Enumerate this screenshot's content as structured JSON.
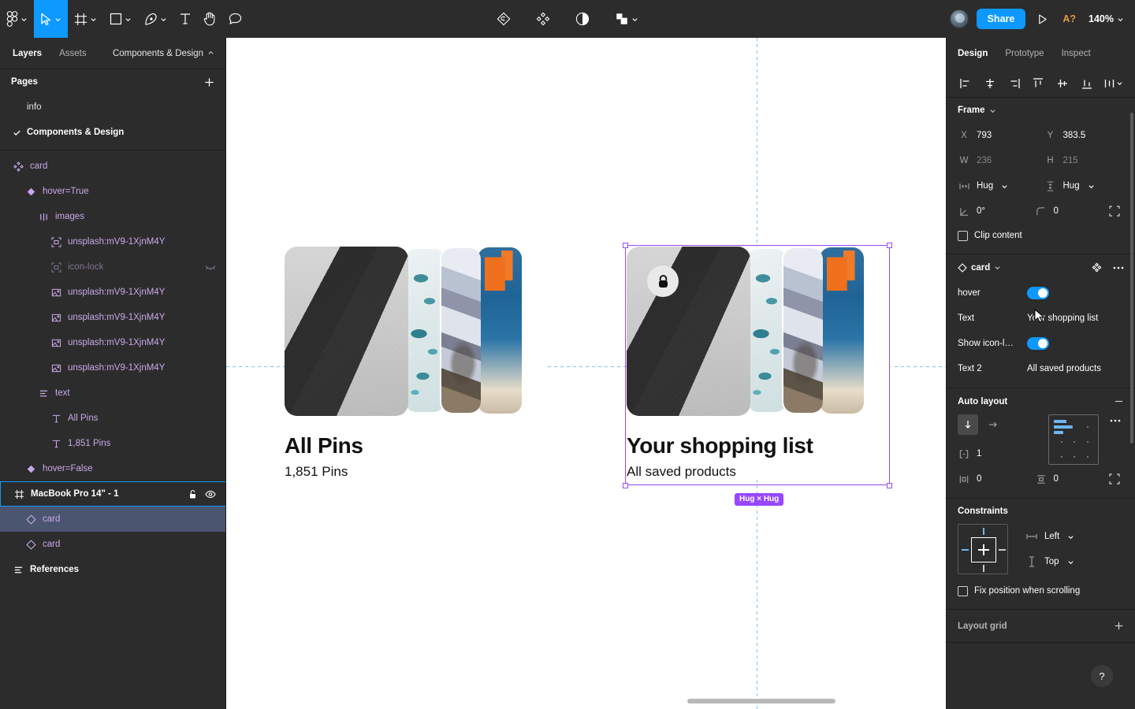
{
  "toolbar": {
    "tools": [
      {
        "name": "figma-menu-icon",
        "label": ""
      },
      {
        "name": "move-tool-icon",
        "label": ""
      },
      {
        "name": "frame-tool-icon",
        "label": ""
      },
      {
        "name": "shape-tool-icon",
        "label": ""
      },
      {
        "name": "pen-tool-icon",
        "label": ""
      },
      {
        "name": "text-tool-icon",
        "label": ""
      },
      {
        "name": "hand-tool-icon",
        "label": ""
      },
      {
        "name": "comment-tool-icon",
        "label": ""
      }
    ],
    "center_actions": [
      "actions-icon",
      "components-icon",
      "contrast-icon",
      "boolean-icon"
    ],
    "share_label": "Share",
    "badge_label": "A?",
    "zoom_level": "140%"
  },
  "left_panel": {
    "tabs": [
      {
        "label": "Layers",
        "active": true
      },
      {
        "label": "Assets",
        "active": false
      }
    ],
    "library_name": "Components & Design",
    "pages_title": "Pages",
    "pages": [
      {
        "label": "info",
        "current": false
      },
      {
        "label": "Components & Design",
        "current": true
      }
    ],
    "layers": [
      {
        "label": "card",
        "icon": "component-set-icon",
        "indent": 0,
        "state": "purple"
      },
      {
        "label": "hover=True",
        "icon": "variant-icon",
        "indent": 1,
        "state": "purple"
      },
      {
        "label": "images",
        "icon": "auto-layout-h-icon",
        "indent": 2,
        "state": "purple"
      },
      {
        "label": "unsplash:mV9-1XjnM4Y",
        "icon": "instance-crop-icon",
        "indent": 3,
        "state": "purple"
      },
      {
        "label": "icon-lock",
        "icon": "instance-crop-icon",
        "indent": 3,
        "state": "dim",
        "hidden": true
      },
      {
        "label": "unsplash:mV9-1XjnM4Y",
        "icon": "image-icon",
        "indent": 3,
        "state": "purple"
      },
      {
        "label": "unsplash:mV9-1XjnM4Y",
        "icon": "image-icon",
        "indent": 3,
        "state": "purple"
      },
      {
        "label": "unsplash:mV9-1XjnM4Y",
        "icon": "image-icon",
        "indent": 3,
        "state": "purple"
      },
      {
        "label": "unsplash:mV9-1XjnM4Y",
        "icon": "image-icon",
        "indent": 3,
        "state": "purple"
      },
      {
        "label": "text",
        "icon": "auto-layout-v-icon",
        "indent": 2,
        "state": "purple"
      },
      {
        "label": "All Pins",
        "icon": "text-layer-icon",
        "indent": 3,
        "state": "purple"
      },
      {
        "label": "1,851 Pins",
        "icon": "text-layer-icon",
        "indent": 3,
        "state": "purple"
      },
      {
        "label": "hover=False",
        "icon": "variant-icon",
        "indent": 1,
        "state": "purple"
      },
      {
        "label": "MacBook Pro 14\" - 1",
        "icon": "frame-icon",
        "indent": 0,
        "state": "white",
        "selected_frame": true,
        "lock": true,
        "eye": true
      },
      {
        "label": "card",
        "icon": "instance-icon",
        "indent": 1,
        "state": "purple",
        "selected_fill": true
      },
      {
        "label": "card",
        "icon": "instance-icon",
        "indent": 1,
        "state": "purple"
      },
      {
        "label": "References",
        "icon": "auto-layout-v-icon",
        "indent": 0,
        "state": "white"
      }
    ]
  },
  "canvas": {
    "cards": [
      {
        "title": "All Pins",
        "subtitle": "1,851 Pins",
        "show_lock": false,
        "selected": false
      },
      {
        "title": "Your shopping list",
        "subtitle": "All saved products",
        "show_lock": true,
        "selected": true,
        "size_badge": "Hug × Hug"
      }
    ]
  },
  "right_panel": {
    "tabs": [
      {
        "label": "Design",
        "active": true
      },
      {
        "label": "Prototype",
        "active": false
      },
      {
        "label": "Inspect",
        "active": false
      }
    ],
    "align_buttons": [
      "align-left-icon",
      "align-horizontal-center-icon",
      "align-right-icon",
      "align-top-icon",
      "align-vertical-center-icon",
      "align-bottom-icon",
      "distribute-icon"
    ],
    "frame": {
      "title": "Frame",
      "x_label": "X",
      "x_value": "793",
      "y_label": "Y",
      "y_value": "383.5",
      "w_label": "W",
      "w_value": "236",
      "h_label": "H",
      "h_value": "215",
      "resize_w_label": "Hug",
      "resize_h_label": "Hug",
      "rotation_value": "0°",
      "corner_radius_value": "0",
      "clip_content_label": "Clip content"
    },
    "component": {
      "title": "card",
      "properties": [
        {
          "label": "hover",
          "type": "toggle",
          "value": true,
          "name": "hover-toggle"
        },
        {
          "label": "Text",
          "type": "text",
          "value": "Your shopping list",
          "name": "text-property"
        },
        {
          "label": "Show icon-l…",
          "type": "toggle",
          "value": true,
          "name": "show-icon-lock-toggle"
        },
        {
          "label": "Text 2",
          "type": "text",
          "value": "All saved products",
          "name": "text2-property"
        }
      ]
    },
    "auto_layout": {
      "title": "Auto layout",
      "direction": "vertical",
      "spacing_value": "1",
      "padding_h_value": "0",
      "padding_v_value": "0"
    },
    "constraints": {
      "title": "Constraints",
      "horizontal": "Left",
      "vertical": "Top",
      "fix_position_label": "Fix position when scrolling"
    },
    "layout_grid": {
      "title": "Layout grid"
    },
    "help_label": "?"
  }
}
